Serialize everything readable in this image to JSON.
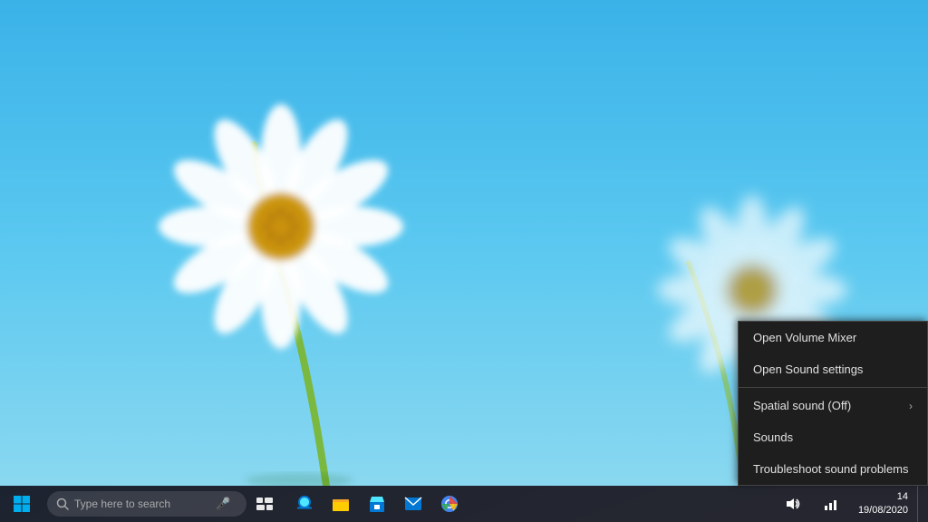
{
  "desktop": {
    "background_description": "Blue sky with daisy flowers"
  },
  "taskbar": {
    "search_placeholder": "Type here to search",
    "clock_time": "14",
    "clock_date": "19/08/2020",
    "apps": [
      {
        "name": "task-view",
        "icon": "⊞",
        "label": "Task View"
      },
      {
        "name": "edge",
        "icon": "e",
        "label": "Microsoft Edge"
      },
      {
        "name": "file-explorer",
        "icon": "📁",
        "label": "File Explorer"
      },
      {
        "name": "store",
        "icon": "🛍",
        "label": "Microsoft Store"
      },
      {
        "name": "mail",
        "icon": "✉",
        "label": "Mail"
      },
      {
        "name": "chrome",
        "icon": "⊙",
        "label": "Google Chrome"
      }
    ]
  },
  "context_menu": {
    "items": [
      {
        "id": "open-volume-mixer",
        "label": "Open Volume Mixer",
        "has_submenu": false,
        "divider_after": false
      },
      {
        "id": "open-sound-settings",
        "label": "Open Sound settings",
        "has_submenu": false,
        "divider_after": true
      },
      {
        "id": "spatial-sound",
        "label": "Spatial sound (Off)",
        "has_submenu": true,
        "divider_after": false
      },
      {
        "id": "sounds",
        "label": "Sounds",
        "has_submenu": false,
        "divider_after": false
      },
      {
        "id": "troubleshoot-sound",
        "label": "Troubleshoot sound problems",
        "has_submenu": false,
        "divider_after": false
      }
    ]
  }
}
